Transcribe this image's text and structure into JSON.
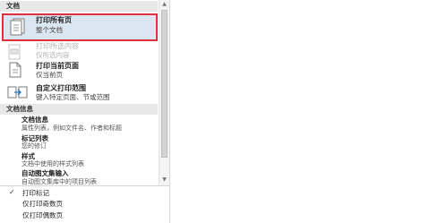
{
  "sections": {
    "document": "文档",
    "document_info": "文档信息"
  },
  "items": [
    {
      "title": "打印所有页",
      "desc": "整个文档",
      "icon": "all-pages-icon"
    },
    {
      "title": "打印所选内容",
      "desc": "仅所选内容",
      "icon": "selection-icon"
    },
    {
      "title": "打印当前页面",
      "desc": "仅当前页",
      "icon": "current-page-icon"
    },
    {
      "title": "自定义打印范围",
      "desc": "键入特定页面、节或范围",
      "icon": "custom-range-icon"
    }
  ],
  "doc_info_items": [
    {
      "title": "文档信息",
      "desc": "属性列表，例如文件名、作者和标题"
    },
    {
      "title": "标记列表",
      "desc": "您的修订"
    },
    {
      "title": "样式",
      "desc": "文档中使用的样式列表"
    },
    {
      "title": "自动图文集输入",
      "desc": "自动图文集库中的项目列表"
    }
  ],
  "options": [
    {
      "label": "打印标记",
      "checked": true
    },
    {
      "label": "仅打印奇数页",
      "checked": false
    },
    {
      "label": "仅打印偶数页",
      "checked": false
    }
  ],
  "scrollbar": {
    "up": "▲",
    "down": "▼"
  },
  "check_mark": "✓",
  "colors": {
    "highlight_border": "#e0303c",
    "selected_bg": "#dbe6f3"
  }
}
